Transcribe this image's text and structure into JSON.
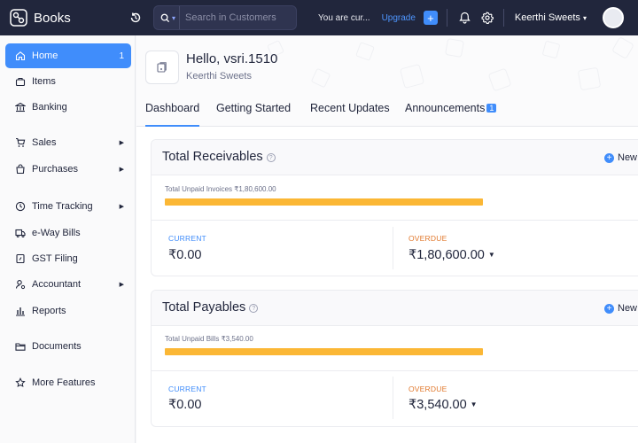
{
  "topbar": {
    "app_name": "Books",
    "search_placeholder": "Search in Customers",
    "trial_text": "You are cur...",
    "upgrade_label": "Upgrade",
    "plus_label": "+",
    "org_name": "Keerthi Sweets",
    "org_caret": "▾"
  },
  "sidebar": {
    "items": [
      {
        "label": "Home",
        "count": "1",
        "icon": "home-icon"
      },
      {
        "label": "Items",
        "icon": "items-icon"
      },
      {
        "label": "Banking",
        "icon": "bank-icon"
      },
      {
        "label": "Sales",
        "icon": "cart-icon",
        "caret": "▶"
      },
      {
        "label": "Purchases",
        "icon": "bag-icon",
        "caret": "▶"
      },
      {
        "label": "Time Tracking",
        "icon": "clock-icon",
        "caret": "▶"
      },
      {
        "label": "e-Way Bills",
        "icon": "truck-icon"
      },
      {
        "label": "GST Filing",
        "icon": "gst-icon"
      },
      {
        "label": "Accountant",
        "icon": "accountant-icon",
        "caret": "▶"
      },
      {
        "label": "Reports",
        "icon": "reports-icon"
      },
      {
        "label": "Documents",
        "icon": "folder-icon"
      },
      {
        "label": "More Features",
        "icon": "star-icon"
      }
    ]
  },
  "header": {
    "greeting": "Hello, vsri.1510",
    "org_sub": "Keerthi Sweets"
  },
  "tabs": [
    {
      "label": "Dashboard"
    },
    {
      "label": "Getting Started"
    },
    {
      "label": "Recent Updates"
    },
    {
      "label": "Announcements",
      "badge": "1"
    }
  ],
  "receivables": {
    "title": "Total Receivables",
    "help": "?",
    "new_label": "New",
    "bar_label": "Total Unpaid Invoices ₹1,80,600.00",
    "overdue_fraction": 1.0,
    "current_label": "CURRENT",
    "current_value": "₹0.00",
    "overdue_label": "OVERDUE",
    "overdue_value": "₹1,80,600.00"
  },
  "payables": {
    "title": "Total Payables",
    "help": "?",
    "new_label": "New",
    "bar_label": "Total Unpaid Bills ₹3,540.00",
    "overdue_fraction": 1.0,
    "current_label": "CURRENT",
    "current_value": "₹0.00",
    "overdue_label": "OVERDUE",
    "overdue_value": "₹3,540.00"
  },
  "colors": {
    "accent": "#408dfb",
    "topbar": "#21263c",
    "bar_overdue": "#fbb735",
    "overdue_text": "#e1782c"
  }
}
